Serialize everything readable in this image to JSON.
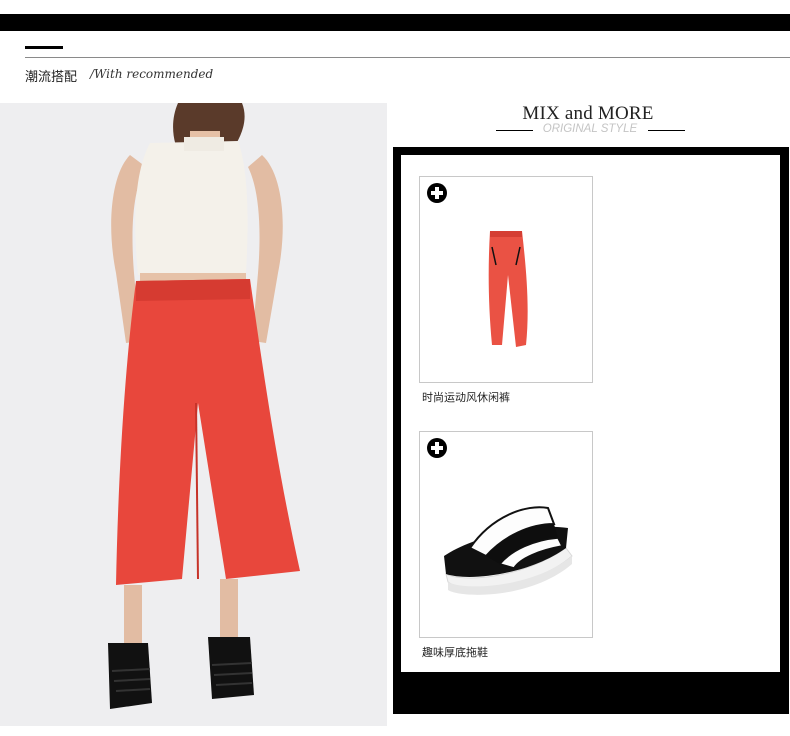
{
  "header": {
    "title": "潮流搭配",
    "subtitle": "/With recommended"
  },
  "mix": {
    "title": "MIX and MORE",
    "subtitle": "ORIGINAL STYLE"
  },
  "products": [
    {
      "name": "时尚运动风休闲裤",
      "icon": "plus-icon"
    },
    {
      "name": "趣味厚底拖鞋",
      "icon": "plus-icon"
    }
  ],
  "colors": {
    "pants_red": "#e8473c",
    "black": "#000000",
    "caption_gray": "#c4c4c4"
  }
}
